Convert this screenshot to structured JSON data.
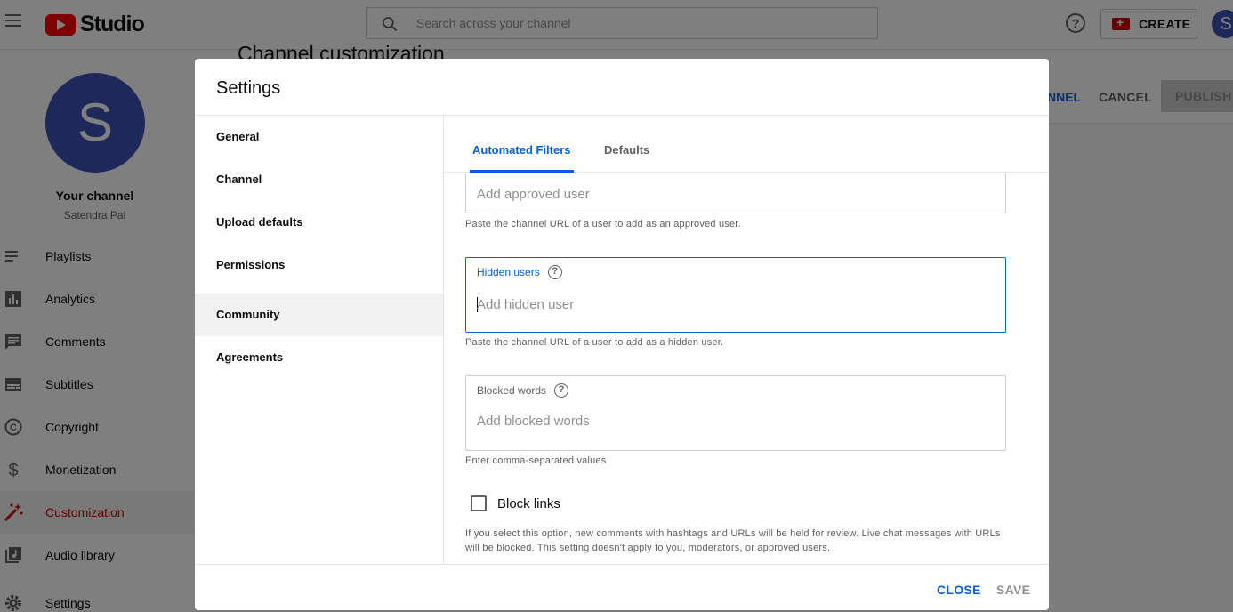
{
  "topbar": {
    "app_name": "Studio",
    "search_placeholder": "Search across your channel",
    "create_label": "CREATE",
    "avatar_initial": "S",
    "accent_color": "#ff0000"
  },
  "sidebar": {
    "avatar_initial": "S",
    "channel_title": "Your channel",
    "channel_owner": "Satendra Pal",
    "items": [
      {
        "label": "Playlists",
        "icon": "playlist-icon"
      },
      {
        "label": "Analytics",
        "icon": "analytics-icon"
      },
      {
        "label": "Comments",
        "icon": "comments-icon"
      },
      {
        "label": "Subtitles",
        "icon": "subtitles-icon"
      },
      {
        "label": "Copyright",
        "icon": "copyright-icon"
      },
      {
        "label": "Monetization",
        "icon": "dollar-icon"
      },
      {
        "label": "Customization",
        "icon": "magic-wand-icon",
        "active": true
      },
      {
        "label": "Audio library",
        "icon": "audio-library-icon"
      },
      {
        "label": "Settings",
        "icon": "gear-icon"
      }
    ]
  },
  "background_page": {
    "title": "Channel customization",
    "channel_link": "NNEL",
    "cancel_label": "CANCEL",
    "publish_label": "PUBLISH"
  },
  "dialog": {
    "title": "Settings",
    "nav": [
      {
        "label": "General"
      },
      {
        "label": "Channel"
      },
      {
        "label": "Upload defaults"
      },
      {
        "label": "Permissions"
      },
      {
        "label": "Community",
        "active": true
      },
      {
        "label": "Agreements"
      }
    ],
    "tabs": [
      {
        "label": "Automated Filters",
        "active": true
      },
      {
        "label": "Defaults"
      }
    ],
    "approved_users": {
      "placeholder": "Add approved user",
      "helper": "Paste the channel URL of a user to add as an approved user."
    },
    "hidden_users": {
      "label": "Hidden users",
      "placeholder": "Add hidden user",
      "helper": "Paste the channel URL of a user to add as a hidden user."
    },
    "blocked_words": {
      "label": "Blocked words",
      "placeholder": "Add blocked words",
      "helper": "Enter comma-separated values"
    },
    "block_links": {
      "label": "Block links",
      "checked": false,
      "description": "If you select this option, new comments with hashtags and URLs will be held for review. Live chat messages with URLs will be blocked. This setting doesn't apply to you, moderators, or approved users."
    },
    "close_label": "CLOSE",
    "save_label": "SAVE",
    "primary_color": "#065fd4"
  }
}
